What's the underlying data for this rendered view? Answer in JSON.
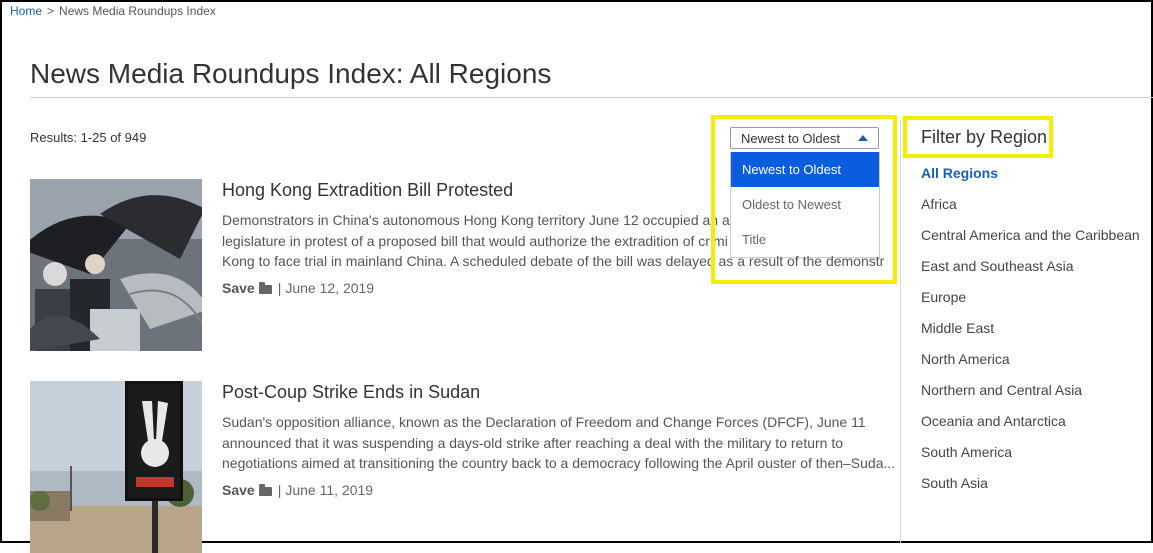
{
  "breadcrumb": {
    "home": "Home",
    "separator": ">",
    "current": "News Media Roundups Index"
  },
  "page_title": "News Media Roundups Index: All Regions",
  "results_text": "Results: 1-25 of 949",
  "sort": {
    "selected": "Newest to Oldest",
    "options": [
      "Newest to Oldest",
      "Oldest to Newest",
      "Title"
    ]
  },
  "articles": [
    {
      "title": "Hong Kong Extradition Bill Protested",
      "lines": [
        "Demonstrators in China's autonomous Hong Kong territory June 12 occupied an a",
        "legislature in protest of a proposed bill that would authorize the extradition of crimi",
        "Kong to face trial in mainland China. A scheduled debate of the bill was delayed as a result of the demonstr"
      ],
      "save": "Save",
      "date": "June 12, 2019"
    },
    {
      "title": "Post-Coup Strike Ends in Sudan",
      "lines": [
        "Sudan's opposition alliance, known as the Declaration of Freedom and Change Forces (DFCF), June 11",
        "announced that it was suspending a days-old strike after reaching a deal with the military to return to",
        "negotiations aimed at transitioning the country back to a democracy following the April ouster of then–Suda..."
      ],
      "save": "Save",
      "date": "June 11, 2019"
    }
  ],
  "filter": {
    "title": "Filter by Region",
    "regions": [
      "All Regions",
      "Africa",
      "Central America and the Caribbean",
      "East and Southeast Asia",
      "Europe",
      "Middle East",
      "North America",
      "Northern and Central Asia",
      "Oceania and Antarctica",
      "South America",
      "South Asia"
    ]
  },
  "colors": {
    "link": "#1a5fb4",
    "highlight": "#f5ee00",
    "active_option": "#0b5de0"
  },
  "icons": [
    "folder-icon",
    "caret-up-icon"
  ]
}
